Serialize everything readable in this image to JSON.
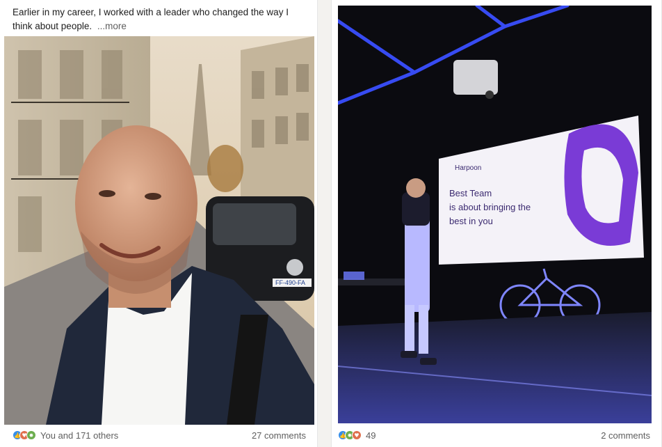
{
  "posts": [
    {
      "text": "Earlier in my career, I worked with a leader who changed the way I think about people.",
      "more_label": "...more",
      "reaction_icons": [
        "like-icon",
        "love-icon",
        "celebrate-icon"
      ],
      "reactions_label": "You and 171 others",
      "comments_label": "27 comments"
    },
    {
      "reaction_icons": [
        "like-icon",
        "celebrate-icon",
        "love-icon"
      ],
      "reactions_label": "49",
      "comments_label": "2 comments",
      "slide": {
        "brand": "Harpoon",
        "headline_lines": [
          "Best Team",
          "is about bringing the",
          "best in you"
        ]
      },
      "car_plate": "FF-490-FA"
    }
  ],
  "colors": {
    "like": "#378fe9",
    "love": "#df704d",
    "celebrate": "#6dae4f",
    "stage_light": "#3a4fff",
    "slide_purple": "#7a3bd6"
  }
}
